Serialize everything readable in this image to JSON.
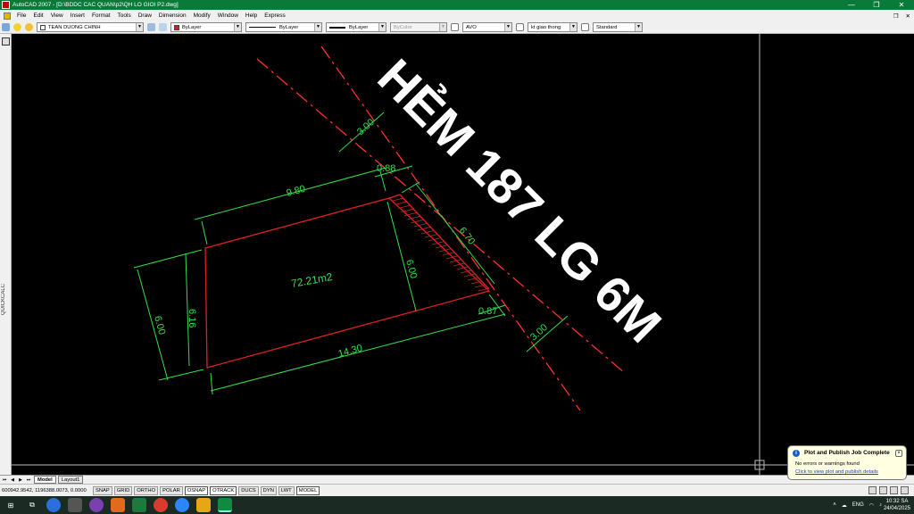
{
  "window": {
    "title": "AutoCAD 2007 - [D:\\BDDC CAC QUAN\\p2\\QH LO GIOI P2.dwg]",
    "minimize": "—",
    "restore": "❐",
    "close": "✕"
  },
  "menu": {
    "items": [
      "File",
      "Edit",
      "View",
      "Insert",
      "Format",
      "Tools",
      "Draw",
      "Dimension",
      "Modify",
      "Window",
      "Help",
      "Express"
    ],
    "restore": "❐",
    "close": "✕"
  },
  "toolbar": {
    "layer": "TEAN DUONG CHINH",
    "color": "ByLayer",
    "color_swatch": "#d42020",
    "linetype": "ByLayer",
    "lineweight": "ByLayer",
    "plotstyle": "ByColor",
    "text_style": "AVO",
    "dim_style": "kt giao thong",
    "table_style": "Standard"
  },
  "side_panel": {
    "label": "QUICKCALC"
  },
  "drawing": {
    "road_label": "HẺM 187 LG 6M",
    "area": "72.21m2",
    "dimensions": {
      "top": "9.80",
      "left_outer": "6.00",
      "left_inner": "6.16",
      "bottom": "14.30",
      "middle": "6.00",
      "right": "6.70",
      "road_top": "3.00",
      "road_bottom": "3.00",
      "corner_top": "0.88",
      "corner_bottom": "0.87"
    },
    "colors": {
      "parcel": "#e02020",
      "dimension": "#33e04a",
      "road_line": "#ff3030",
      "road_label": "#ffffff",
      "hatch": "#e02020"
    }
  },
  "layout_tabs": {
    "nav": [
      "⏮",
      "◀",
      "▶",
      "⏭"
    ],
    "tabs": [
      "Model",
      "Layout1"
    ]
  },
  "status": {
    "coords": "600942.9542, 1196388.0073, 0.0000",
    "buttons": [
      "SNAP",
      "GRID",
      "ORTHO",
      "POLAR",
      "OSNAP",
      "OTRACK",
      "DUCS",
      "DYN",
      "LWT",
      "MODEL"
    ]
  },
  "notification": {
    "title": "Plot and Publish Job Complete",
    "message": "No errors or warnings found",
    "link": "Click to view plot and publish details"
  },
  "taskbar": {
    "lang": "ENG",
    "time": "10:32 SA",
    "date": "24/04/2025"
  }
}
